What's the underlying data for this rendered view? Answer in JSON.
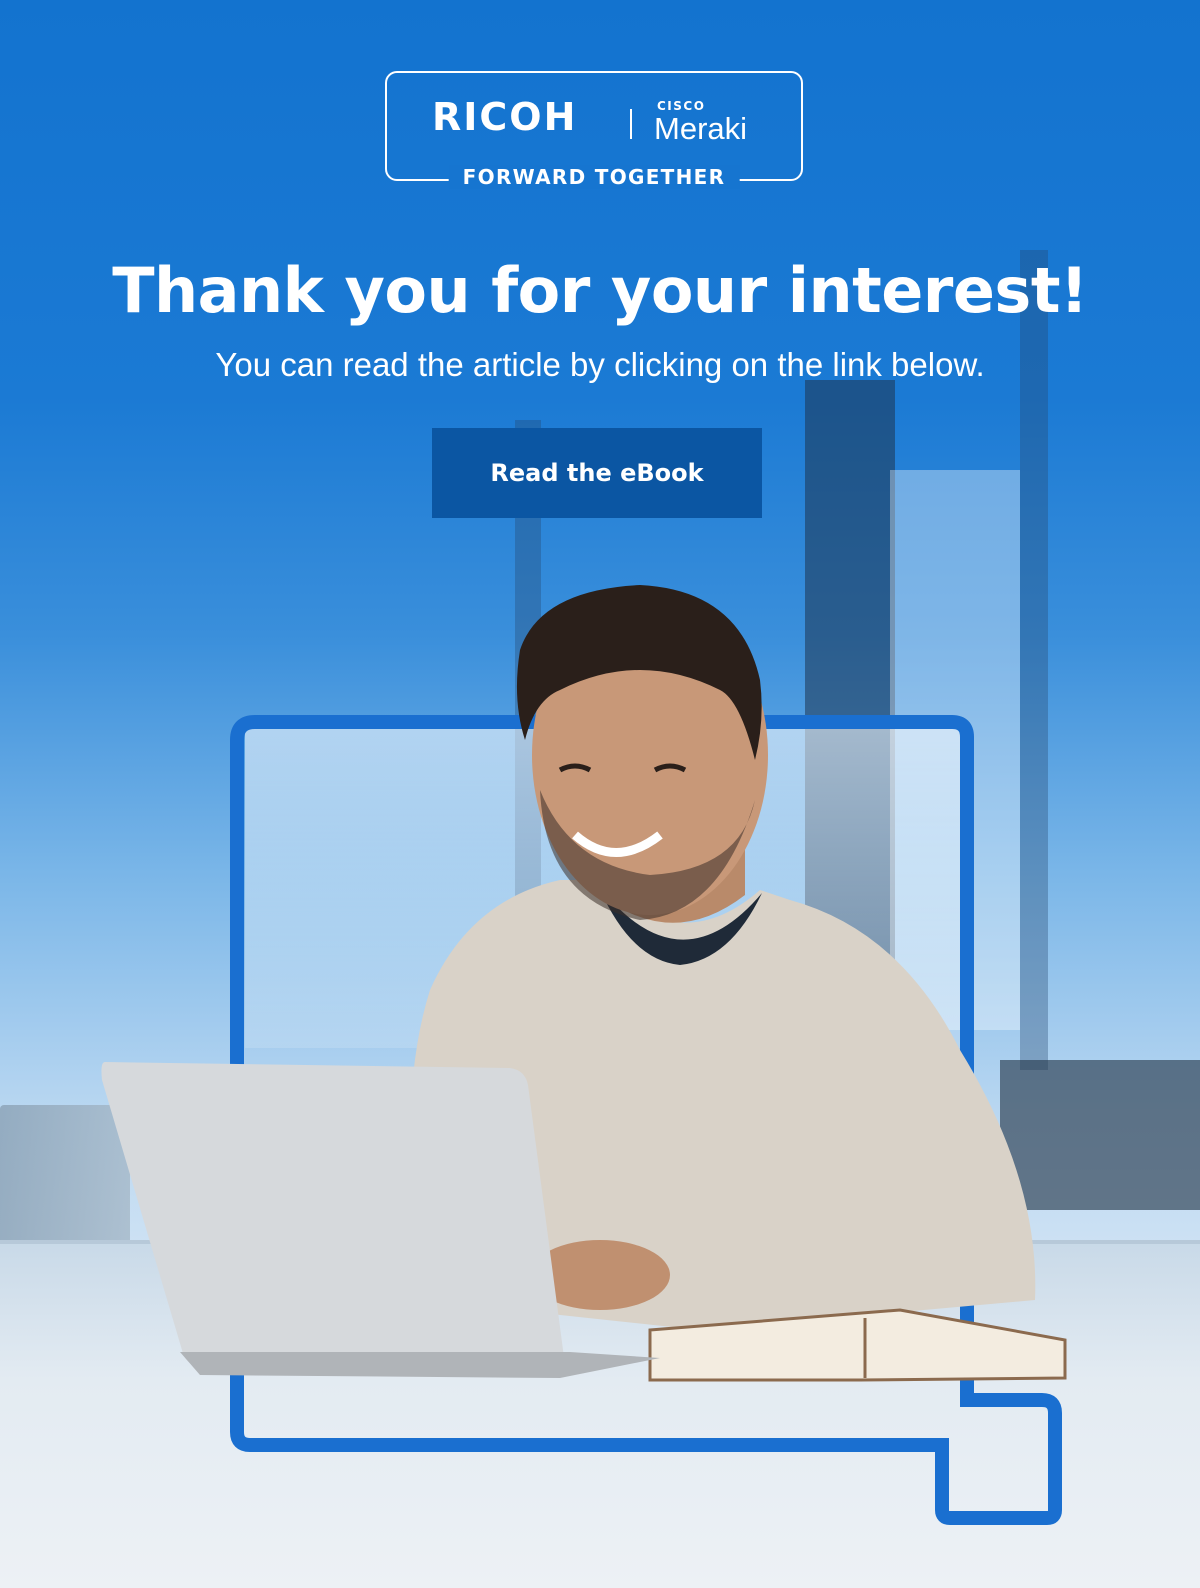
{
  "logo": {
    "brand": "RICOH",
    "partner_top": "CISCO",
    "partner_name": "Meraki",
    "tagline": "FORWARD TOGETHER"
  },
  "hero": {
    "headline": "Thank you for your interest!",
    "subline": "You can read the article by clicking on the link below.",
    "cta_label": "Read the eBook"
  },
  "colors": {
    "primary_blue": "#1675d0",
    "button_blue": "#0b56a3",
    "frame_blue": "#1a6fd0",
    "text": "#ffffff"
  }
}
